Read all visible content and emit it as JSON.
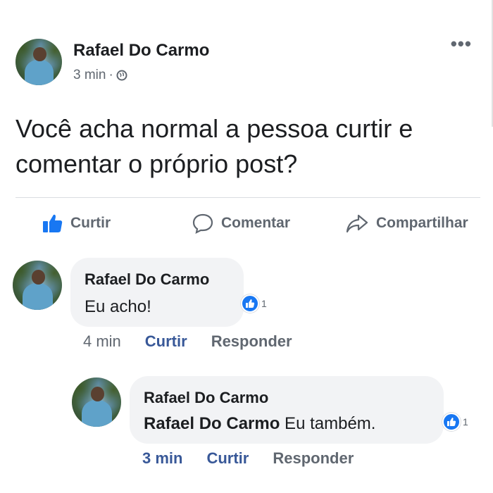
{
  "post": {
    "author": "Rafael Do Carmo",
    "time": "3 min",
    "separator": "·",
    "more_label": "•••",
    "text": "Você acha normal a pessoa curtir e comentar o próprio post?"
  },
  "actions": {
    "like_label": "Curtir",
    "comment_label": "Comentar",
    "share_label": "Compartilhar"
  },
  "comments": [
    {
      "author": "Rafael Do Carmo",
      "text": "Eu acho!",
      "reactions": "1",
      "time": "4 min",
      "like_label": "Curtir",
      "reply_label": "Responder"
    },
    {
      "author": "Rafael Do Carmo",
      "mention": "Rafael Do Carmo",
      "text": " Eu também.",
      "reactions": "1",
      "time": "3 min",
      "like_label": "Curtir",
      "reply_label": "Responder"
    }
  ],
  "colors": {
    "brand_blue": "#1877f2",
    "link_blue": "#385898",
    "text_secondary": "#606770",
    "bubble_bg": "#f2f3f5"
  },
  "icons": {
    "globe": "globe-icon",
    "like": "thumbs-up-icon",
    "comment": "speech-bubble-icon",
    "share": "share-arrow-icon",
    "reaction": "like-reaction-icon"
  }
}
